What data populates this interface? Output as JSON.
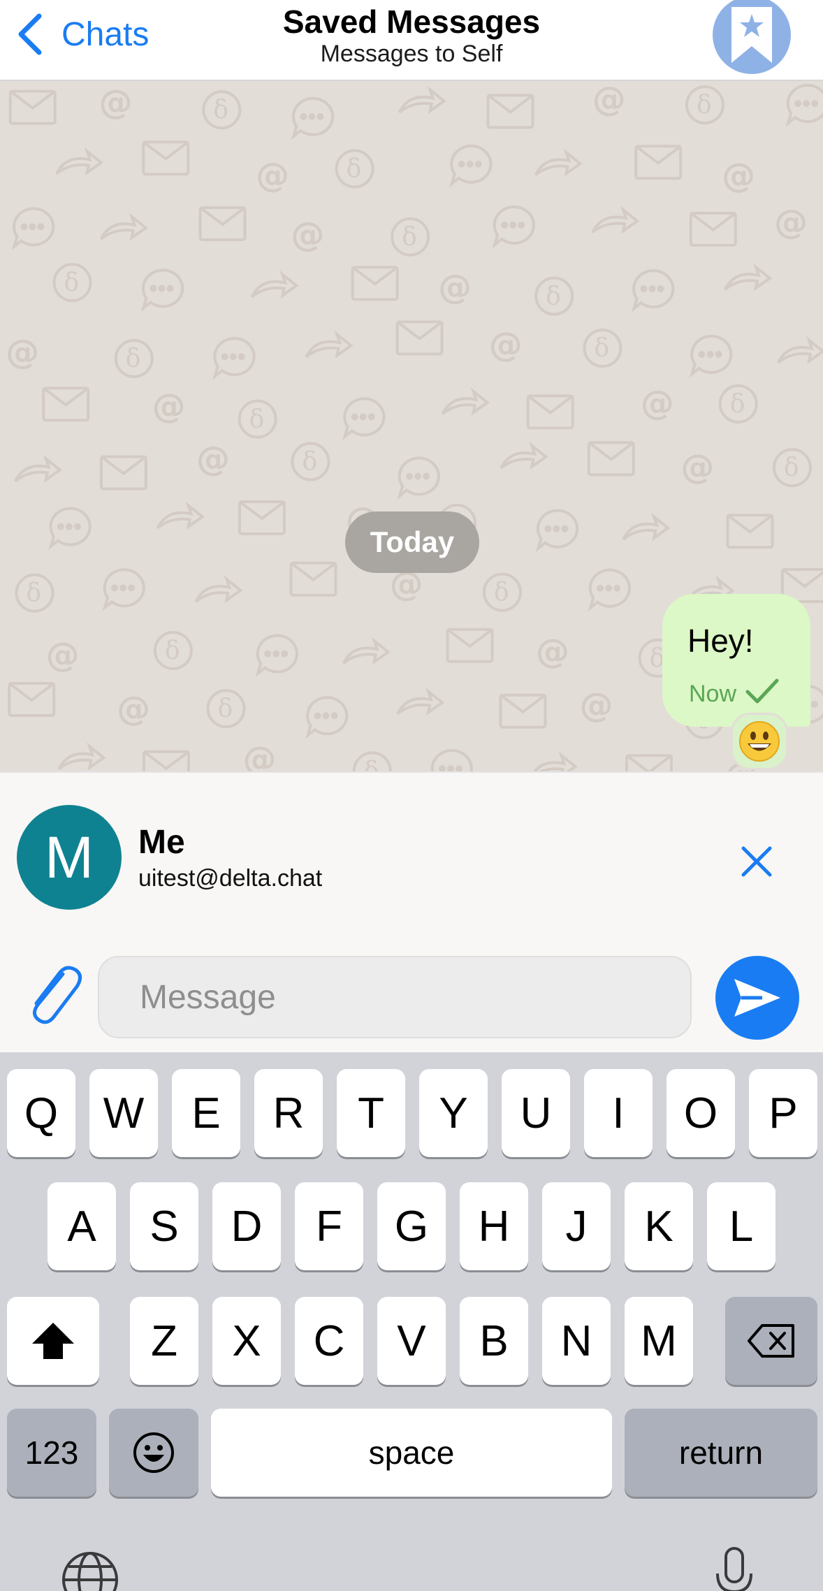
{
  "nav": {
    "back_label": "Chats",
    "title": "Saved Messages",
    "subtitle": "Messages to Self",
    "avatar_icon": "bookmark-star-icon"
  },
  "chat": {
    "date_label": "Today",
    "messages": [
      {
        "text": "Hey!",
        "time": "Now",
        "status_icon": "checkmark-icon",
        "reaction": "😀",
        "outgoing": true
      }
    ]
  },
  "quote": {
    "avatar_letter": "M",
    "name": "Me",
    "address": "uitest@delta.chat",
    "close_icon": "close-icon"
  },
  "composer": {
    "placeholder": "Message",
    "attach_icon": "paperclip-icon",
    "send_icon": "send-icon"
  },
  "keyboard": {
    "row1": [
      "Q",
      "W",
      "E",
      "R",
      "T",
      "Y",
      "U",
      "I",
      "O",
      "P"
    ],
    "row2": [
      "A",
      "S",
      "D",
      "F",
      "G",
      "H",
      "J",
      "K",
      "L"
    ],
    "row3": [
      "Z",
      "X",
      "C",
      "V",
      "B",
      "N",
      "M"
    ],
    "numbers_label": "123",
    "space_label": "space",
    "return_label": "return",
    "icons": [
      "shift-icon",
      "backspace-icon",
      "emoji-icon",
      "globe-icon",
      "microphone-icon"
    ]
  },
  "colors": {
    "accent": "#1a7cf2",
    "bubble_outgoing": "#dcf8c6",
    "chat_background": "#e3ddd8",
    "avatar_me": "#0f8291",
    "saved_avatar": "#8fb2e6"
  }
}
